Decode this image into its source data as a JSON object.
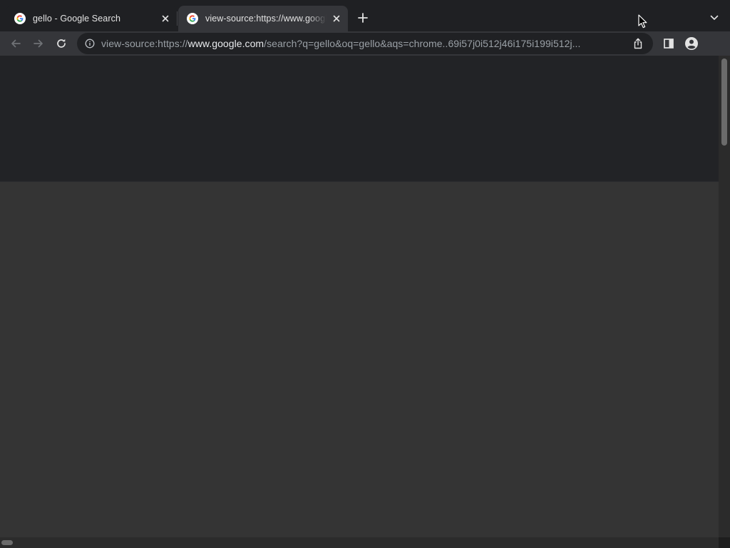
{
  "tabs": [
    {
      "title": "gello - Google Search",
      "active": false,
      "favicon": "google-g-icon"
    },
    {
      "title": "view-source:https://www.google.com/search?q=gello",
      "active": true,
      "favicon": "google-g-icon"
    }
  ],
  "toolbar": {
    "url_scheme": "view-source:https://",
    "url_host": "www.google.com",
    "url_path": "/search?q=gello&oq=gello&aqs=chrome..69i57j0i512j46i175i199i512j...",
    "icons": {
      "back": "back-arrow-icon",
      "forward": "forward-arrow-icon",
      "reload": "reload-icon",
      "site_info": "info-icon",
      "share": "share-icon",
      "side_panel": "side-panel-icon",
      "profile": "profile-icon"
    }
  },
  "scrollbars": {
    "vertical_position": 0.0,
    "horizontal_position": 0.0
  },
  "colors": {
    "tabstrip_bg": "#1f2023",
    "toolbar_bg": "#35363a",
    "omnibox_bg": "#202124",
    "content_bg": "#343434",
    "content_top_bg": "#222326"
  }
}
